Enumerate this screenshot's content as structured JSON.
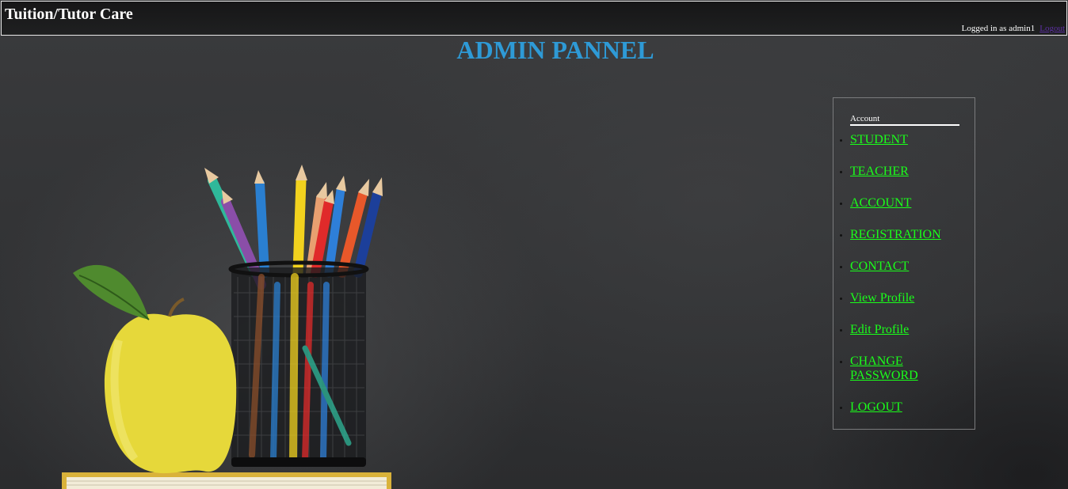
{
  "header": {
    "site_title": "Tuition/Tutor Care",
    "logged_in_text": "Logged in as admin1",
    "logout_link": "Logout"
  },
  "main": {
    "page_title": "ADMIN PANNEL"
  },
  "sidebar": {
    "heading": "Account",
    "items": [
      {
        "label": "STUDENT"
      },
      {
        "label": "TEACHER"
      },
      {
        "label": "ACCOUNT"
      },
      {
        "label": "REGISTRATION"
      },
      {
        "label": "CONTACT"
      },
      {
        "label": "View Profile"
      },
      {
        "label": "Edit Profile"
      },
      {
        "label": "CHANGE PASSWORD"
      },
      {
        "label": "LOGOUT"
      }
    ]
  },
  "colors": {
    "title_blue": "#2e9ad6",
    "link_green": "#1aff1a",
    "header_bg": "#1a1a1b"
  },
  "background": {
    "image": "chalkboard-apple-pencils-illustration"
  }
}
